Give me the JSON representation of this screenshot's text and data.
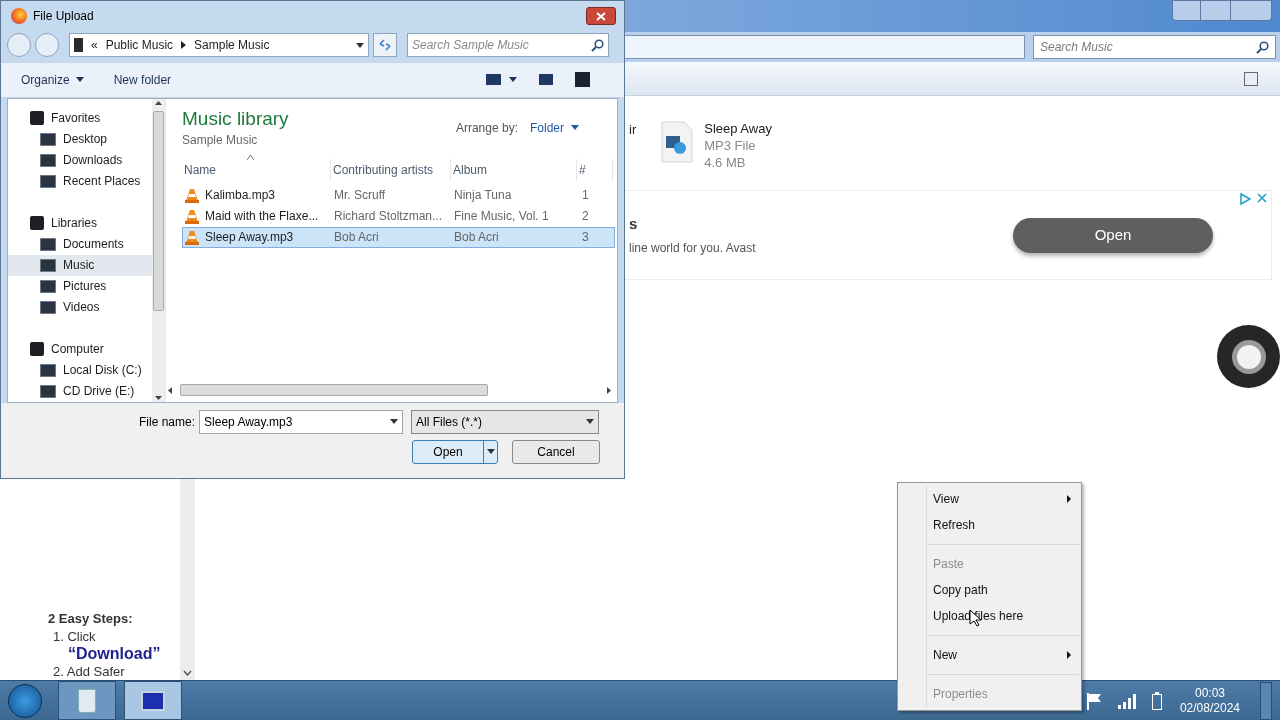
{
  "explorer": {
    "search_placeholder": "Search Music",
    "partial_item_label": "ir",
    "file": {
      "name": "Sleep Away",
      "type": "MP3 File",
      "size": "4.6 MB"
    },
    "ad": {
      "title_fragment": "s",
      "text_fragment": "line world for you. Avast",
      "button": "Open"
    },
    "sidebar_ad": {
      "heading": "2 Easy Steps:",
      "steps": [
        {
          "text": "1. Click",
          "highlight": "“Download”"
        },
        {
          "text": "2. Add Safer"
        }
      ]
    }
  },
  "dialog": {
    "title": "File Upload",
    "address_overflow": "«",
    "address": [
      "Public Music",
      "Sample Music"
    ],
    "search_placeholder": "Search Sample Music",
    "toolbar": [
      {
        "label": "Organize",
        "has_menu": true
      },
      {
        "label": "New folder",
        "has_menu": false
      }
    ],
    "tree": [
      {
        "label": "Favorites",
        "selected": false,
        "children": [
          {
            "label": "Desktop",
            "selected": false
          },
          {
            "label": "Downloads",
            "selected": false
          },
          {
            "label": "Recent Places",
            "selected": false
          }
        ]
      },
      {
        "label": "Libraries",
        "selected": false,
        "children": [
          {
            "label": "Documents",
            "selected": false
          },
          {
            "label": "Music",
            "selected": true
          },
          {
            "label": "Pictures",
            "selected": false
          },
          {
            "label": "Videos",
            "selected": false
          }
        ]
      },
      {
        "label": "Computer",
        "selected": false,
        "children": [
          {
            "label": "Local Disk (C:)",
            "selected": false
          },
          {
            "label": "CD Drive (E:)",
            "selected": false
          }
        ]
      }
    ],
    "library_title": "Music library",
    "library_subtitle": "Sample Music",
    "arrange_label": "Arrange by:",
    "arrange_value": "Folder",
    "columns": [
      "Name",
      "Contributing artists",
      "Album",
      "#"
    ],
    "rows": [
      {
        "name": "Kalimba.mp3",
        "artists": "Mr. Scruff",
        "album": "Ninja Tuna",
        "number": "1",
        "selected": false
      },
      {
        "name": "Maid with the Flaxe...",
        "artists": "Richard Stoltzman...",
        "album": "Fine Music, Vol. 1",
        "number": "2",
        "selected": false
      },
      {
        "name": "Sleep Away.mp3",
        "artists": "Bob Acri",
        "album": "Bob Acri",
        "number": "3",
        "selected": true
      }
    ],
    "file_name_label": "File name:",
    "file_name": "Sleep Away.mp3",
    "file_type": "All Files (*.*)",
    "buttons": [
      {
        "label": "Open",
        "kind": "split"
      },
      {
        "label": "Cancel",
        "kind": "plain"
      }
    ]
  },
  "context_menu": [
    {
      "kind": "item",
      "label": "View",
      "disabled": false,
      "submenu": true
    },
    {
      "kind": "item",
      "label": "Refresh",
      "disabled": false,
      "submenu": false
    },
    {
      "kind": "separator"
    },
    {
      "kind": "item",
      "label": "Paste",
      "disabled": true,
      "submenu": false
    },
    {
      "kind": "item",
      "label": "Copy path",
      "disabled": false,
      "submenu": false
    },
    {
      "kind": "item",
      "label": "Upload files here",
      "disabled": false,
      "submenu": false
    },
    {
      "kind": "separator"
    },
    {
      "kind": "item",
      "label": "New",
      "disabled": false,
      "submenu": true
    },
    {
      "kind": "separator"
    },
    {
      "kind": "item",
      "label": "Properties",
      "disabled": true,
      "submenu": false
    }
  ],
  "taskbar": {
    "time": "00:03",
    "date": "02/08/2024",
    "buttons": [
      {
        "kind": "recycle-bin",
        "selected": false
      },
      {
        "kind": "computer",
        "selected": true
      }
    ]
  }
}
